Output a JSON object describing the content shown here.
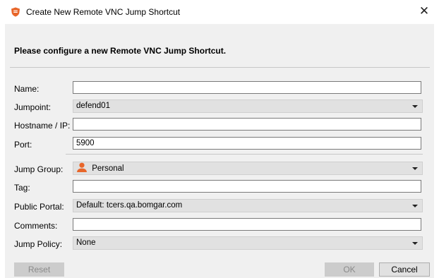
{
  "window": {
    "title": "Create New Remote VNC Jump Shortcut",
    "close_symbol": "✕",
    "app_icon": "bomgar-shield-icon"
  },
  "heading": "Please configure a new Remote VNC Jump Shortcut.",
  "fields": {
    "name": {
      "label": "Name:",
      "value": ""
    },
    "jumpoint": {
      "label": "Jumpoint:",
      "value": "defend01"
    },
    "hostname": {
      "label": "Hostname / IP:",
      "value": ""
    },
    "port": {
      "label": "Port:",
      "value": "5900"
    },
    "jump_group": {
      "label": "Jump Group:",
      "value": "Personal",
      "icon": "person-icon"
    },
    "tag": {
      "label": "Tag:",
      "value": ""
    },
    "public_portal": {
      "label": "Public Portal:",
      "value": "Default: tcers.qa.bomgar.com"
    },
    "comments": {
      "label": "Comments:",
      "value": ""
    },
    "jump_policy": {
      "label": "Jump Policy:",
      "value": "None"
    }
  },
  "buttons": {
    "reset": "Reset",
    "ok": "OK",
    "cancel": "Cancel"
  },
  "colors": {
    "dialog_bg": "#f0f0f0",
    "select_bg": "#e1e1e1",
    "disabled_button_bg": "#cccccc",
    "icon_orange": "#e8662a"
  }
}
